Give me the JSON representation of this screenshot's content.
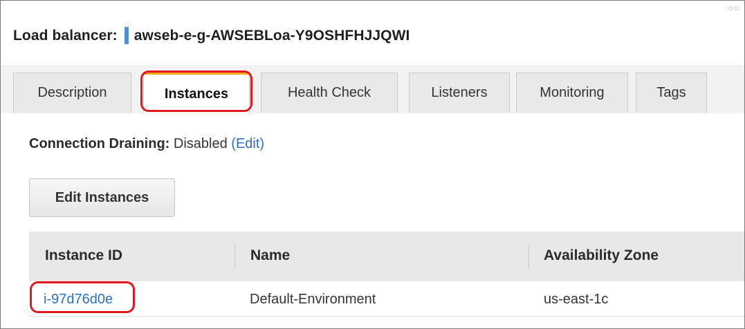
{
  "header": {
    "label": "Load balancer:",
    "name": "awseb-e-g-AWSEBLoa-Y9OSHFHJJQWI"
  },
  "tabs": [
    {
      "label": "Description",
      "active": false
    },
    {
      "label": "Instances",
      "active": true
    },
    {
      "label": "Health Check",
      "active": false
    },
    {
      "label": "Listeners",
      "active": false
    },
    {
      "label": "Monitoring",
      "active": false
    },
    {
      "label": "Tags",
      "active": false
    }
  ],
  "connection_draining": {
    "label": "Connection Draining:",
    "value": "Disabled",
    "edit_link": "(Edit)"
  },
  "edit_instances_button": "Edit Instances",
  "table": {
    "columns": [
      "Instance ID",
      "Name",
      "Availability Zone"
    ],
    "rows": [
      [
        "i-97d76d0e",
        "Default-Environment",
        "us-east-1c"
      ]
    ]
  },
  "colors": {
    "accent_bar": "#4a90d9",
    "link": "#2e6fbd",
    "highlight": "#e4161e",
    "active_tab_top": "#f5a623"
  }
}
